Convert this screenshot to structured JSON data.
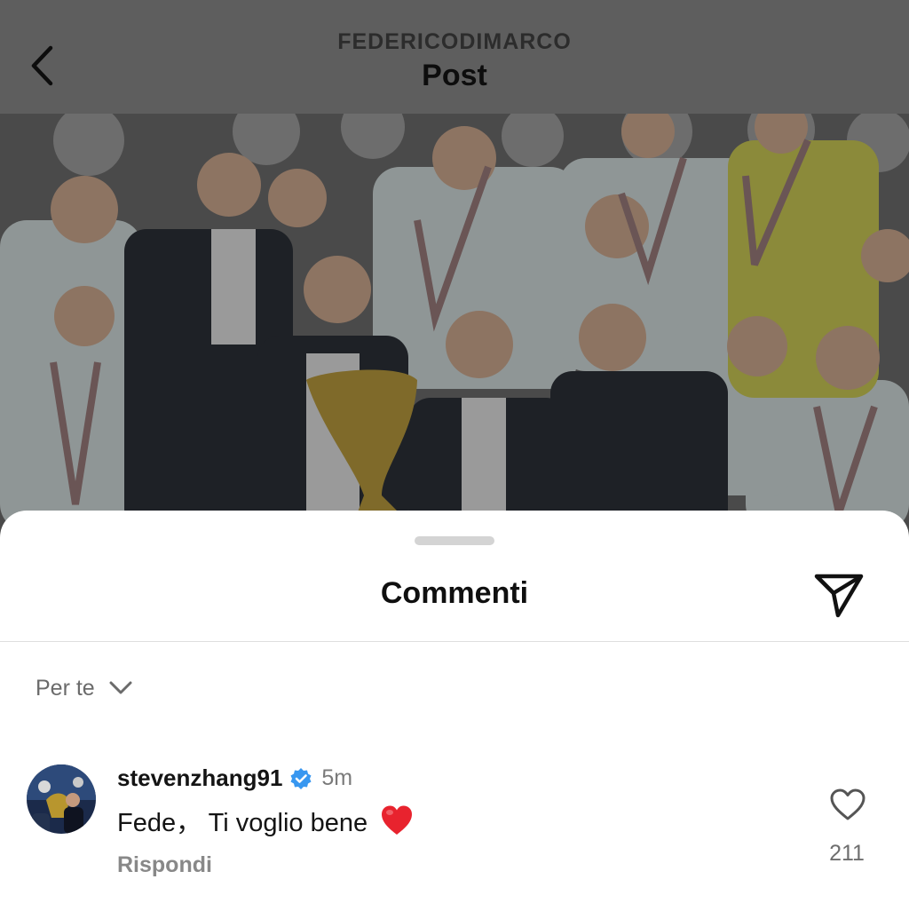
{
  "header": {
    "username": "FEDERICODIMARCO",
    "title": "Post",
    "back_icon": "chevron-left-icon"
  },
  "photo": {
    "subject": "team-celebration-photo",
    "overlay_color": "#000000"
  },
  "sheet": {
    "title": "Commenti",
    "share_icon": "paper-plane-icon"
  },
  "sort": {
    "label": "Per te",
    "icon": "chevron-down-icon"
  },
  "comment": {
    "username": "stevenzhang91",
    "verified": true,
    "time": "5m",
    "text": "Fede， Ti voglio bene",
    "emoji": "red-heart",
    "reply_label": "Rispondi",
    "like_count": "211"
  },
  "colors": {
    "verified_blue": "#3897f0",
    "heart_red": "#e8232e",
    "text_primary": "#141414",
    "text_secondary": "#7a7a7a"
  }
}
